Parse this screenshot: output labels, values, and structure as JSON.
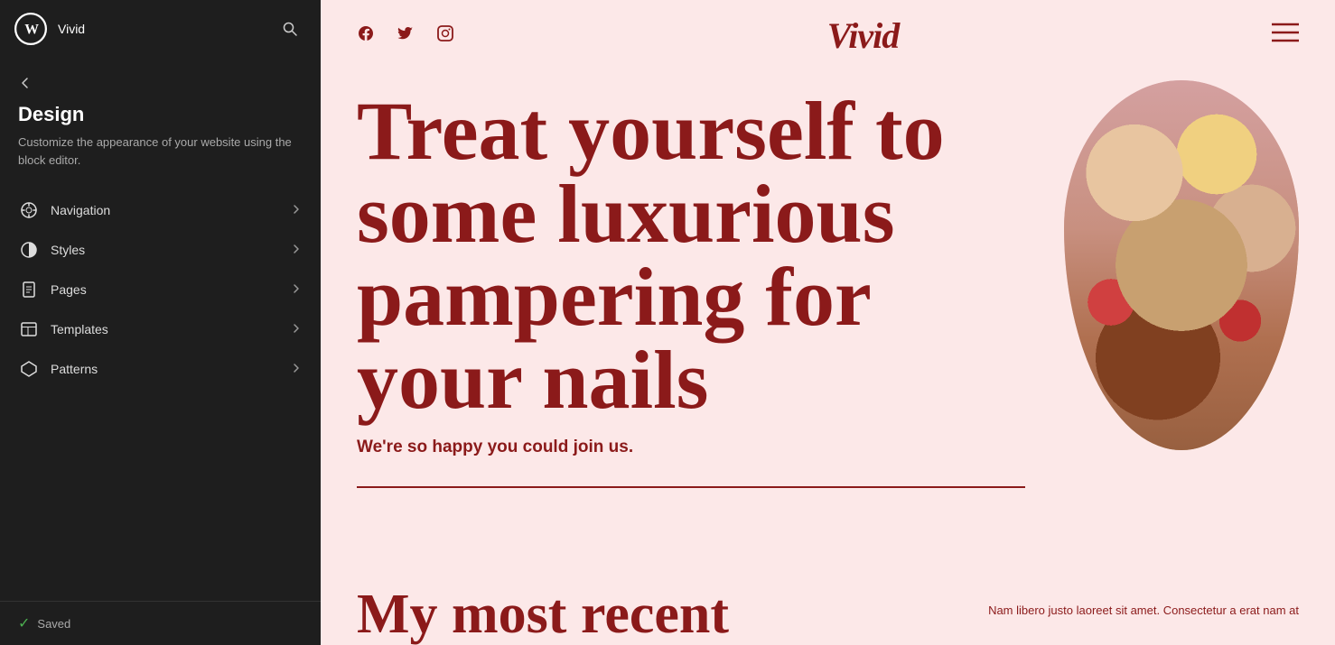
{
  "sidebar": {
    "site_name": "Vivid",
    "wp_logo_label": "WordPress",
    "search_label": "Search",
    "back_label": "Back",
    "design": {
      "title": "Design",
      "description": "Customize the appearance of your website using the block editor."
    },
    "nav_items": [
      {
        "id": "navigation",
        "label": "Navigation",
        "icon": "compass"
      },
      {
        "id": "styles",
        "label": "Styles",
        "icon": "half-circle"
      },
      {
        "id": "pages",
        "label": "Pages",
        "icon": "document"
      },
      {
        "id": "templates",
        "label": "Templates",
        "icon": "layout"
      },
      {
        "id": "patterns",
        "label": "Patterns",
        "icon": "diamond"
      }
    ],
    "footer": {
      "saved_label": "Saved",
      "saved_icon": "check"
    }
  },
  "preview": {
    "social_icons": [
      "facebook",
      "twitter",
      "instagram"
    ],
    "logo_text": "Vivid",
    "menu_icon": "hamburger",
    "hero": {
      "main_title": "Treat yourself to some luxurious pampering for your nails",
      "subtitle": "We're so happy you could join us."
    },
    "bottom_section": {
      "left_text": "My most recent",
      "right_text": "Nam libero justo laoreet sit amet. Consectetur a erat nam at"
    }
  },
  "colors": {
    "sidebar_bg": "#1e1e1e",
    "preview_bg": "#fce8e8",
    "brand_red": "#8b1a1a",
    "text_light": "#aaaaaa",
    "saved_green": "#4caf50"
  }
}
